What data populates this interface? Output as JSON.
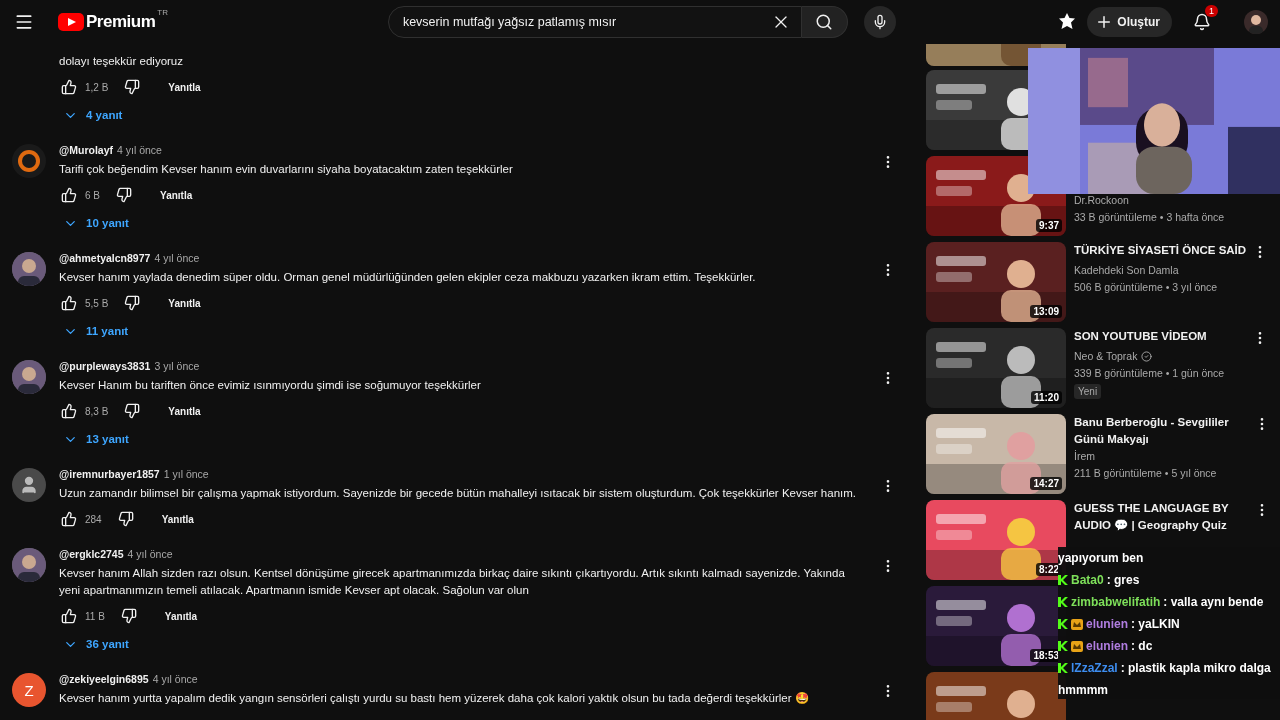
{
  "topbar": {
    "logo_text": "Premium",
    "region": "TR",
    "search_value": "kevserin mutfağı yağsız patlamış mısır",
    "create_label": "Oluştur",
    "notification_count": "1"
  },
  "comments": [
    {
      "text": "dolayı teşekkür ediyoruz",
      "likes": "1,2 B",
      "reply_label": "Yanıtla",
      "replies": "4 yanıt"
    },
    {
      "username": "@Murolayf",
      "time": "4 yıl önce",
      "text": "Tarifi çok beğendim Kevser hanım evin duvarlarını siyaha boyatacaktım zaten teşekkürler",
      "likes": "6 B",
      "reply_label": "Yanıtla",
      "replies": "10 yanıt",
      "avatar": {
        "kind": "emblem"
      }
    },
    {
      "username": "@ahmetyalcn8977",
      "time": "4 yıl önce",
      "text": "Kevser hanım yaylada denedim süper oldu. Orman genel müdürlüğünden gelen ekipler ceza makbuzu yazarken ikram ettim. Teşekkürler.",
      "likes": "5,5 B",
      "reply_label": "Yanıtla",
      "replies": "11 yanıt"
    },
    {
      "username": "@purpleways3831",
      "time": "3 yıl önce",
      "text": "Kevser Hanım bu tariften önce evimiz ısınmıyordu şimdi ise soğumuyor teşekkürler",
      "likes": "8,3 B",
      "reply_label": "Yanıtla",
      "replies": "13 yanıt"
    },
    {
      "username": "@iremnurbayer1857",
      "time": "1 yıl önce",
      "text": "Uzun zamandır bilimsel bir çalışma yapmak istiyordum. Sayenizde bir gecede bütün mahalleyi ısıtacak bir sistem oluşturdum. Çok teşekkürler Kevser hanım.",
      "likes": "284",
      "reply_label": "Yanıtla",
      "avatar": {
        "kind": "default"
      }
    },
    {
      "username": "@ergklc2745",
      "time": "4 yıl önce",
      "text": "Kevser hanım Allah sizden razı olsun. Kentsel dönüşüme girecek apartmanımızda birkaç daire sıkıntı çıkartıyordu. Artık sıkıntı kalmadı sayenizde. Yakında yeni apartmanımızın temeli atılacak. Apartmanın ismide Kevser apt olacak. Sağolun var olun",
      "likes": "11 B",
      "reply_label": "Yanıtla",
      "replies": "36 yanıt"
    },
    {
      "username": "@zekiyeelgin6895",
      "time": "4 yıl önce",
      "text": "Kevser hanım yurtta yapalım dedik yangın sensörleri çalıştı yurdu su bastı hem yüzerek daha çok kalori yaktık olsun bu tada değerdi teşekkürler 🤩",
      "avatar": {
        "kind": "letter",
        "letter": "Z"
      }
    }
  ],
  "videos": [
    {
      "kind": "partial"
    },
    {
      "kind": "video"
    },
    {
      "kind": "video",
      "duration": "9:37",
      "channel": "Dr.Rockoon",
      "meta": "33 B görüntüleme • 3 hafta önce"
    },
    {
      "kind": "video",
      "title": "TÜRKİYE SİYASETİ ÖNCE SAİD",
      "duration": "13:09",
      "channel": "Kadehdeki Son Damla",
      "meta": "506 B görüntüleme • 3 yıl önce"
    },
    {
      "kind": "video",
      "title": "SON YOUTUBE VİDEOM",
      "duration": "11:20",
      "channel": "Neo & Toprak",
      "verified": true,
      "meta": "339 B görüntüleme • 1 gün önce",
      "tag": "Yeni"
    },
    {
      "kind": "video",
      "title": "Banu Berberoğlu - Sevgililer Günü Makyajı",
      "duration": "14:27",
      "channel": "İrem",
      "meta": "211 B görüntüleme • 5 yıl önce"
    },
    {
      "kind": "video",
      "title": "GUESS THE LANGUAGE BY AUDIO 💬 | Geography Quiz",
      "duration": "8:22"
    },
    {
      "kind": "video",
      "duration": "18:53"
    },
    {
      "kind": "video"
    }
  ],
  "chat": [
    {
      "text": "yapıyorum ben"
    },
    {
      "user": "Bata0",
      "text": ": gres",
      "color": "#7ee05a",
      "crown": false
    },
    {
      "user": "zimbabwelifatih",
      "text": ": valla aynı bende",
      "color": "#7ee05a",
      "crown": false
    },
    {
      "user": "elunien",
      "text": ": yaLKIN",
      "color": "#b07de0",
      "crown": true
    },
    {
      "user": "elunien",
      "text": ": dc",
      "color": "#b07de0",
      "crown": true
    },
    {
      "user": "lZzaZzal",
      "text": ": plastik kapla mikro dalga",
      "color": "#3d8df0",
      "crown": false
    },
    {
      "text": "hmmmm"
    }
  ]
}
